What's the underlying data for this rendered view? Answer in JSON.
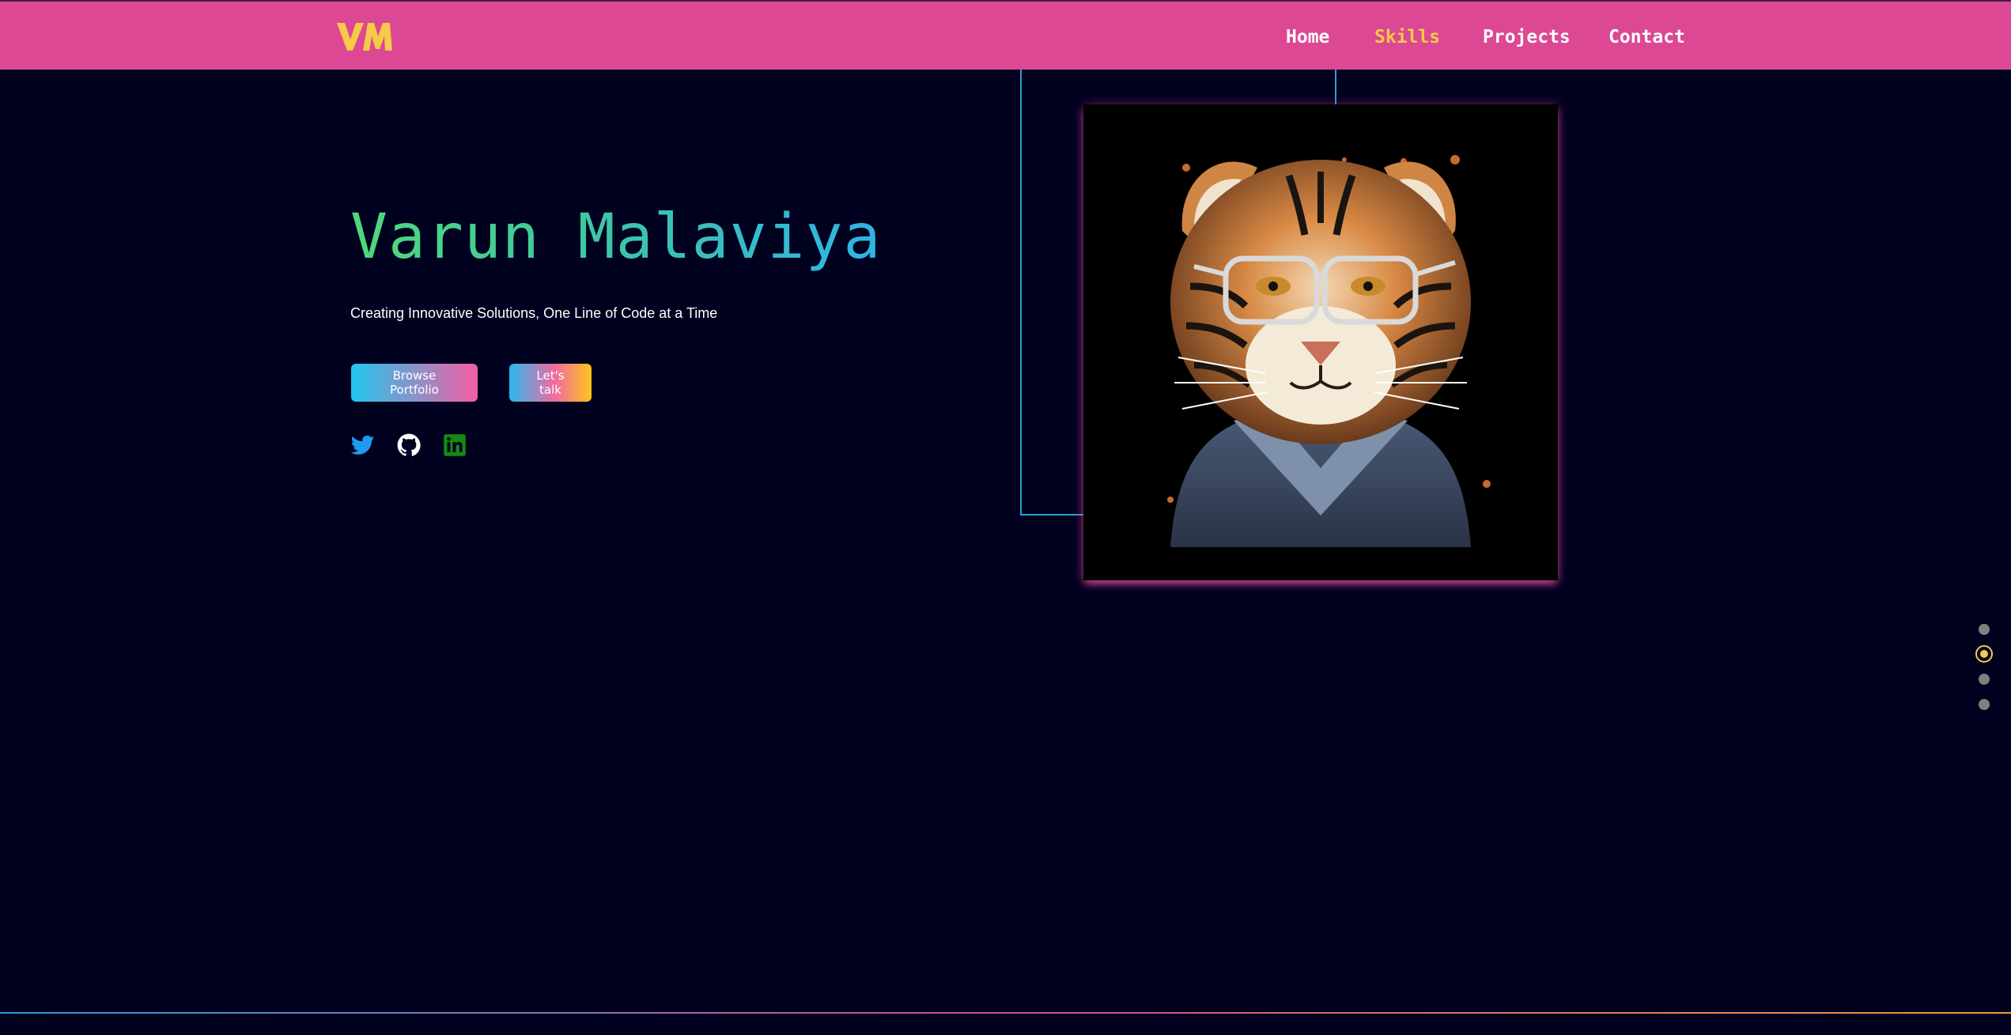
{
  "header": {
    "logo_text": "VM",
    "nav": [
      {
        "label": "Home",
        "active": false
      },
      {
        "label": "Skills",
        "active": true
      },
      {
        "label": "Projects",
        "active": false
      },
      {
        "label": "Contact",
        "active": false
      }
    ]
  },
  "hero": {
    "name": "Varun Malaviya",
    "tagline": "Creating Innovative Solutions, One Line of Code at a Time",
    "buttons": {
      "portfolio_label": "Browse Portfolio",
      "talk_label": "Let's talk"
    },
    "socials": [
      {
        "icon": "twitter-icon",
        "color": "#1d9bf0"
      },
      {
        "icon": "github-icon",
        "color": "#ffffff"
      },
      {
        "icon": "linkedin-icon",
        "color": "#138a13"
      }
    ]
  },
  "portrait": {
    "alt": "Tiger wearing glasses"
  },
  "section_dots": {
    "count": 4,
    "active_index": 1
  },
  "colors": {
    "navbar": "#dc4893",
    "background": "#00001f",
    "accent_yellow": "#f7c948",
    "line_blue": "#2f9fd4"
  }
}
